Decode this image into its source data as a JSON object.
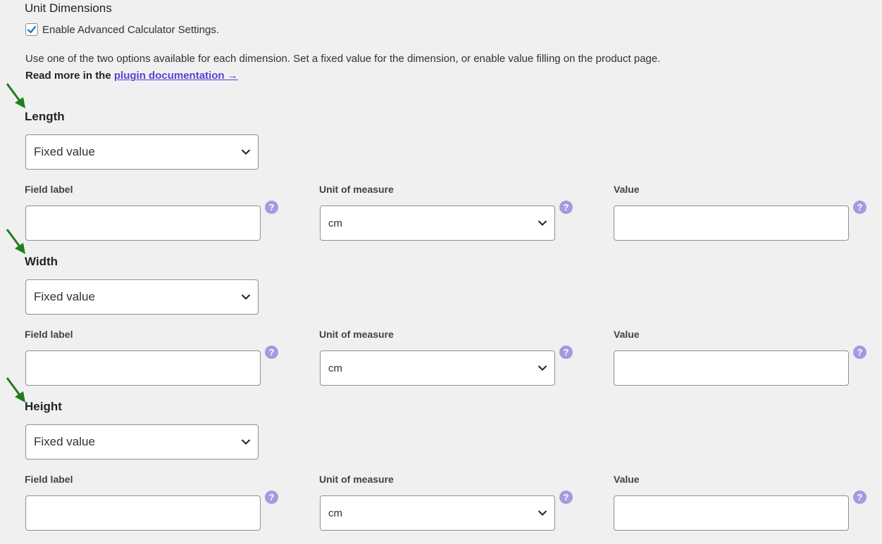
{
  "header": {
    "title": "Unit Dimensions",
    "enable_label": "Enable Advanced Calculator Settings.",
    "enable_checked": true,
    "description": "Use one of the two options available for each dimension. Set a fixed value for the dimension, or enable value filling on the product page.",
    "read_more_prefix": "Read more in the",
    "read_more_link": "plugin documentation →"
  },
  "columns": {
    "field_label": "Field label",
    "unit_of_measure": "Unit of measure",
    "value": "Value"
  },
  "help_glyph": "?",
  "dimensions": [
    {
      "name": "Length",
      "mode": "Fixed value",
      "field_label_value": "",
      "unit": "cm",
      "value": ""
    },
    {
      "name": "Width",
      "mode": "Fixed value",
      "field_label_value": "",
      "unit": "cm",
      "value": ""
    },
    {
      "name": "Height",
      "mode": "Fixed value",
      "field_label_value": "",
      "unit": "cm",
      "value": ""
    }
  ],
  "colors": {
    "accent_arrow": "#1e7d1e",
    "link": "#5b3fd1",
    "help": "#a19cdf"
  }
}
